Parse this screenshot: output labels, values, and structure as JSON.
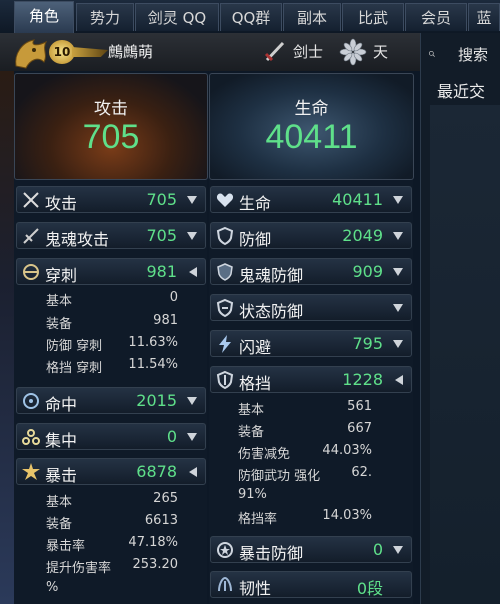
{
  "tabs": [
    "角色",
    "势力",
    "剑灵 QQ",
    "QQ群",
    "副本",
    "比武",
    "会员",
    "蓝"
  ],
  "header": {
    "level": "10",
    "name": "鷓鷓萌",
    "class": "剑士",
    "server": "天"
  },
  "search_label": "搜索",
  "recent_label": "最近交际",
  "attack_panel": {
    "title": "攻击",
    "value": "705"
  },
  "hp_panel": {
    "title": "生命",
    "value": "40411"
  },
  "left": {
    "attack": {
      "label": "攻击",
      "value": "705"
    },
    "ghost_attack": {
      "label": "鬼魂攻击",
      "value": "705"
    },
    "pierce": {
      "label": "穿刺",
      "value": "981",
      "subs": [
        {
          "label": "基本",
          "value": "0"
        },
        {
          "label": "装备",
          "value": "981"
        },
        {
          "label": "防御 穿刺",
          "value": "11.63%"
        },
        {
          "label": "格挡 穿刺",
          "value": "11.54%"
        }
      ]
    },
    "hit": {
      "label": "命中",
      "value": "2015"
    },
    "focus": {
      "label": "集中",
      "value": "0"
    },
    "crit": {
      "label": "暴击",
      "value": "6878",
      "subs": [
        {
          "label": "基本",
          "value": "265"
        },
        {
          "label": "装备",
          "value": "6613"
        },
        {
          "label": "暴击率",
          "value": "47.18%"
        },
        {
          "label": "提升伤害率",
          "value": "253.20"
        }
      ],
      "wrap": "%"
    }
  },
  "right": {
    "hp": {
      "label": "生命",
      "value": "40411"
    },
    "defense": {
      "label": "防御",
      "value": "2049"
    },
    "ghost_defense": {
      "label": "鬼魂防御",
      "value": "909"
    },
    "status_defense": {
      "label": "状态防御",
      "value": ""
    },
    "evade": {
      "label": "闪避",
      "value": "795"
    },
    "block": {
      "label": "格挡",
      "value": "1228",
      "subs": [
        {
          "label": "基本",
          "value": "561"
        },
        {
          "label": "装备",
          "value": "667"
        },
        {
          "label": "伤害减免",
          "value": "44.03%"
        },
        {
          "label": "防御武功 强化",
          "value": "62."
        },
        {
          "label": "91%",
          "value": ""
        },
        {
          "label": "格挡率",
          "value": "14.03%"
        }
      ]
    },
    "crit_defense": {
      "label": "暴击防御",
      "value": "0"
    },
    "toughness": {
      "label": "韧性",
      "value": "0段"
    }
  },
  "colors": {
    "value_green": "#5fe08a",
    "accent_tab": "#4d6179"
  }
}
